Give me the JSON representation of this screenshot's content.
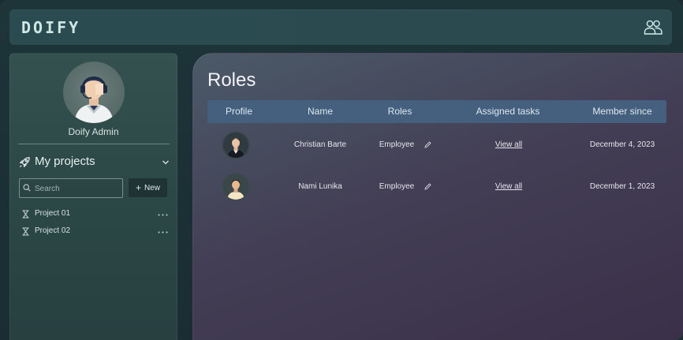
{
  "app": {
    "logo": "DOIFY",
    "header_icon": "users-icon"
  },
  "sidebar": {
    "admin_name": "Doify Admin",
    "projects_title": "My projects",
    "search_placeholder": "Search",
    "new_button_label": "New",
    "projects": [
      {
        "label": "Project 01"
      },
      {
        "label": "Project 02"
      }
    ]
  },
  "main": {
    "title": "Roles",
    "columns": [
      "Profile",
      "Name",
      "Roles",
      "Assigned tasks",
      "Member since"
    ],
    "rows": [
      {
        "name": "Christian Barte",
        "role": "Employee",
        "tasks_link": "View all",
        "member_since": "December 4, 2023"
      },
      {
        "name": "Nami Lunika",
        "role": "Employee",
        "tasks_link": "View all",
        "member_since": "December 1, 2023"
      }
    ]
  },
  "colors": {
    "header_bg": "#2a4b50",
    "sidebar_bg": "#34514f",
    "table_header_bg": "#44607e",
    "main_bg": "#433e55"
  }
}
